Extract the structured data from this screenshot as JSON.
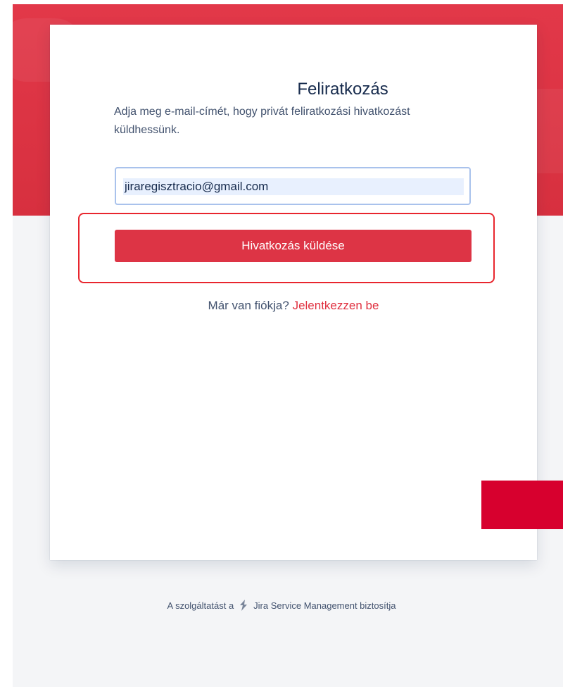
{
  "card": {
    "title": "Feliratkozás",
    "subtitle": "Adja meg e-mail-címét, hogy privát feliratkozási hivatkozást küldhessünk.",
    "email_value": "jiraregisztracio@gmail.com",
    "send_button_label": "Hivatkozás küldése",
    "login_prompt": "Már van fiókja?",
    "login_link": "Jelentkezzen be"
  },
  "footer": {
    "prefix": "A szolgáltatást a",
    "product": "Jira Service Management biztosítja",
    "icon": "jira-service-management-icon"
  },
  "colors": {
    "brand_red": "#dd3445",
    "banner_red": "#e23849",
    "link_red": "#e03241",
    "highlight_outline": "#e8262e",
    "corner_block": "#d7002e"
  }
}
